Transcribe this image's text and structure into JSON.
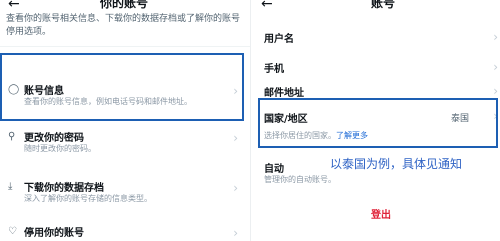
{
  "left": {
    "back_icon": "arrow-left-icon",
    "title": "你的账号",
    "description": "查看你的账号相关信息、下载你的数据存档或了解你的账号停用选项。",
    "items": [
      {
        "icon": "person-icon",
        "label": "账号信息",
        "sub": "查看你的账号信息，例如电话号码和邮件地址。"
      },
      {
        "icon": "key-icon",
        "label": "更改你的密码",
        "sub": "随时更改你的密码。"
      },
      {
        "icon": "download-icon",
        "label": "下载你的数据存档",
        "sub": "深入了解你的账号存储的信息类型。"
      },
      {
        "icon": "broken-heart-icon",
        "label": "停用你的账号",
        "sub": ""
      }
    ]
  },
  "right": {
    "back_icon": "arrow-left-icon",
    "title": "账号",
    "items": [
      {
        "label": "用户名"
      },
      {
        "label": "手机"
      },
      {
        "label": "邮件地址"
      }
    ],
    "country": {
      "label": "国家/地区",
      "value": "泰国",
      "desc": "选择你居住的国家。",
      "link": "了解更多"
    },
    "automation": {
      "label": "自动",
      "desc": "管理你的自动账号。"
    },
    "logout": "登出"
  },
  "annotation": "以泰国为例，具体见通知",
  "colors": {
    "highlight": "#1d5fb3",
    "logout": "#e0243a",
    "link": "#1d6ad6",
    "annotation": "#2f63c5"
  }
}
